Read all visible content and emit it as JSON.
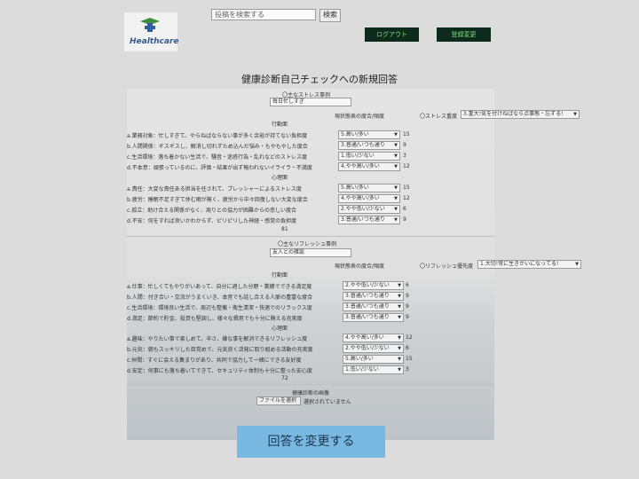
{
  "header": {
    "logo_text": "Healthcare",
    "search_placeholder": "投稿を検索する",
    "search_button": "検索",
    "logout": "ログアウト",
    "settings": "登録変更"
  },
  "page_title": "健康診断自己チェックへの新規回答",
  "stress": {
    "example_label": "〇主なストレス事例",
    "example_value": "毎日忙しすぎ",
    "freq_header": "現状態表の度合/頻度",
    "importance_label": "〇ストレス重度",
    "importance_value": "3.重大!気を付けねばなら点事態・忘ずる!",
    "behavior_header": "行動面",
    "mental_header": "心理面",
    "behavior_items": [
      {
        "label": "a.業務対象：忙しすぎて、やらねばならない事が多く余裕が持てない負担度",
        "select": "5.高い/多い",
        "score": "15"
      },
      {
        "label": "b.人間関係：ギスギスし、解消し切れずため込んだ悩み・もやもやした度合",
        "select": "3.普通/いつも通り",
        "score": "9"
      },
      {
        "label": "c.生活環境：落ち着かない生活で、騒音・迷惑行為・乱れなどのストレス度",
        "select": "1.低い/少ない",
        "score": "3"
      },
      {
        "label": "d.不本意：頑張っているのに、評価・結果が出ず報われないイライラ・不満度",
        "select": "4.やや高い/多い",
        "score": "12"
      }
    ],
    "mental_items": [
      {
        "label": "a.責任：大変な責任ある担当を任されて、プレッシャーによるストレス度",
        "select": "5.高い/多い",
        "score": "15"
      },
      {
        "label": "b.疲労：睡眠不足すぎて休む暇が無く、疲労から中々回復しない大変な度合",
        "select": "4.やや高い/多い",
        "score": "12"
      },
      {
        "label": "c.孤立：助け合える関係がなく、周りとの協力が困難からの悲しい度合",
        "select": "2.やや低い/少ない",
        "score": "6"
      },
      {
        "label": "d.不安：何をすれば良いかわからず、ピリピリした神経・感覚の負担度",
        "select": "3.普通/いつも通り",
        "score": "9"
      }
    ],
    "total": "81"
  },
  "refresh": {
    "example_label": "〇主なリフレッシュ事例",
    "example_value": "友人との雑談",
    "freq_header": "現状態表の度合/頻度",
    "priority_label": "〇リフレッシュ優先度",
    "priority_value": "1.大切!常に生きがいになってる!",
    "behavior_header": "行動面",
    "mental_header": "心理面",
    "behavior_items": [
      {
        "label": "a.仕事：忙しくてもやりがいあって、自分に適した分野・業績でできる満足度",
        "select": "2.やや低い/少ない",
        "score": "6"
      },
      {
        "label": "b.人間：付き合い・交流がうまくいき、本音でも話し合える人脈の豊富な度合",
        "select": "3.普通/いつも通り",
        "score": "9"
      },
      {
        "label": "c.生活環境：環境良い生活で、周辺も整備・衛生清潔・快適でのリラックス度",
        "select": "3.普通/いつも通り",
        "score": "9"
      },
      {
        "label": "d.満足：節約で貯金、投資も堅調し、様々な費用でも十分に賄える充実度",
        "select": "3.普通/いつも通り",
        "score": "9"
      }
    ],
    "mental_items": [
      {
        "label": "a.趣味：やりたい事で楽しめて、辛さ、嫌な事を解消できるリフレッシュ度",
        "select": "4.やや高い/多い",
        "score": "12"
      },
      {
        "label": "b.元気：朝もスッキリした目覚めで、元気良く活発に取り組める活動の充実度",
        "select": "2.やや低い/少ない",
        "score": "6"
      },
      {
        "label": "c.仲間：すぐに会える集まりがあり、共同で協力して一緒にできる友好度",
        "select": "5.高い/多い",
        "score": "15"
      },
      {
        "label": "d.安定：何事にも落ち着いてできて、セキュリティ体制も十分に整った安心度",
        "select": "1.低い/少ない",
        "score": "3"
      }
    ],
    "total": "72"
  },
  "image_upload": {
    "label": "健康診断の画像",
    "button": "ファイルを選択",
    "status": "選択されていません"
  },
  "submit_label": "回答を変更する"
}
